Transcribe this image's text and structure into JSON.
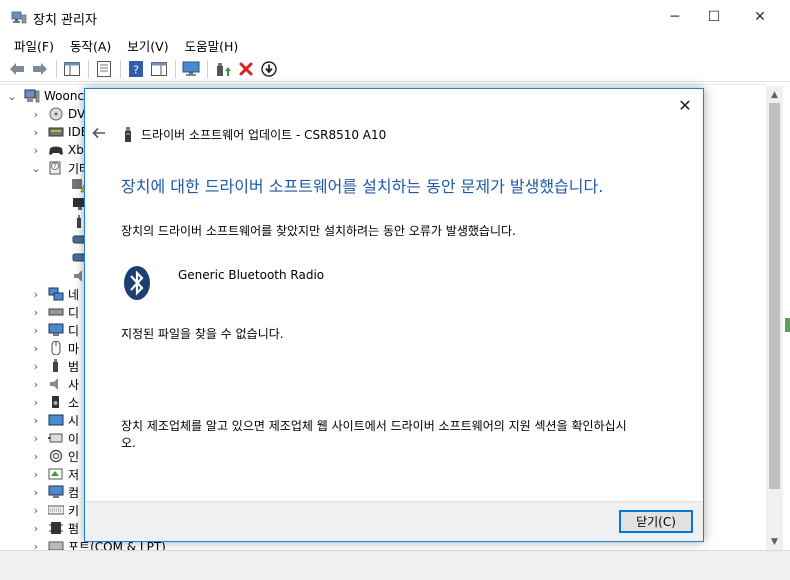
{
  "window": {
    "title": "장치 관리자",
    "controls": {
      "minimize": "─",
      "maximize": "☐",
      "close": "✕"
    }
  },
  "menu": [
    "파일(F)",
    "동작(A)",
    "보기(V)",
    "도움말(H)"
  ],
  "toolbar": {
    "buttons": [
      "back",
      "forward",
      "properties-pane",
      "properties",
      "help",
      "action-pane",
      "monitor",
      "update-driver",
      "uninstall",
      "download"
    ]
  },
  "tree": {
    "root": "Woonc",
    "items": [
      {
        "label": "DV",
        "icon": "disc-drive-icon"
      },
      {
        "label": "IDE",
        "icon": "ide-controller-icon"
      },
      {
        "label": "Xb",
        "icon": "gamepad-icon"
      },
      {
        "label": "기타",
        "icon": "unknown-device-icon",
        "expanded": true
      },
      {
        "label": "",
        "icon": "warning-device-icon"
      },
      {
        "label": "",
        "icon": "display-icon"
      },
      {
        "label": "",
        "icon": "usb-device-icon"
      },
      {
        "label": "",
        "icon": "network-card-icon"
      },
      {
        "label": "",
        "icon": "network-card-icon"
      },
      {
        "label": "",
        "icon": "audio-icon"
      },
      {
        "label": "네",
        "icon": "network-icon"
      },
      {
        "label": "디",
        "icon": "disk-icon"
      },
      {
        "label": "디",
        "icon": "display-adapter-icon"
      },
      {
        "label": "마",
        "icon": "mouse-icon"
      },
      {
        "label": "범",
        "icon": "usb-controller-icon"
      },
      {
        "label": "사",
        "icon": "speaker-icon"
      },
      {
        "label": "소",
        "icon": "sound-icon"
      },
      {
        "label": "시",
        "icon": "system-icon"
      },
      {
        "label": "이",
        "icon": "portable-device-icon"
      },
      {
        "label": "인",
        "icon": "biometric-icon"
      },
      {
        "label": "저",
        "icon": "storage-icon"
      },
      {
        "label": "컴",
        "icon": "computer-icon"
      },
      {
        "label": "키",
        "icon": "keyboard-icon"
      },
      {
        "label": "펌",
        "icon": "firmware-icon"
      },
      {
        "label": "포트(COM & LPT)",
        "icon": "port-icon"
      }
    ]
  },
  "dialog": {
    "header_title": "드라이버 소프트웨어 업데이트 - CSR8510 A10",
    "heading": "장치에 대한 드라이버 소프트웨어를 설치하는 동안 문제가 발생했습니다.",
    "description": "장치의 드라이버 소프트웨어를 찾았지만 설치하려는 동안 오류가 발생했습니다.",
    "device_name": "Generic Bluetooth Radio",
    "error_text": "지정된 파일을 찾을 수 없습니다.",
    "hint_text": "장치 제조업체를 알고 있으면 제조업체 웹 사이트에서 드라이버 소프트웨어의 지원 섹션을 확인하십시오.",
    "close_button": "닫기(C)"
  },
  "colors": {
    "heading_blue": "#1f5aa6",
    "dialog_border": "#1883d7",
    "bluetooth": "#1b3f73",
    "delete_red": "#d32020"
  }
}
